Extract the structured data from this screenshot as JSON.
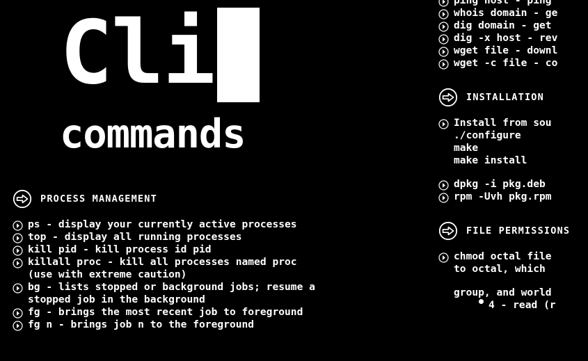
{
  "theme": {
    "background": "#000000",
    "foreground": "#ffffff"
  },
  "title": {
    "text": "Cli",
    "cursor": "block-cursor",
    "subtitle": "commands"
  },
  "left_column": {
    "sections": [
      {
        "heading": "PROCESS MANAGEMENT",
        "heading_icon": "circle-arrow-right-icon",
        "entries": [
          {
            "icon": "circle-play-icon",
            "lines": [
              "ps - display your currently active processes"
            ]
          },
          {
            "icon": "circle-play-icon",
            "lines": [
              "top - display all running processes"
            ]
          },
          {
            "icon": "circle-play-icon",
            "lines": [
              "kill pid - kill process id pid"
            ]
          },
          {
            "icon": "circle-play-icon",
            "lines": [
              "killall proc - kill all processes named proc",
              "(use with extreme caution)"
            ]
          },
          {
            "icon": "circle-play-icon",
            "lines": [
              "bg - lists stopped or background jobs; resume a",
              "stopped job in the background"
            ]
          },
          {
            "icon": "circle-play-icon",
            "lines": [
              "fg - brings the most recent job to foreground"
            ]
          },
          {
            "icon": "circle-play-icon",
            "lines": [
              "fg n - brings job n to the foreground"
            ]
          }
        ]
      }
    ]
  },
  "right_column": {
    "networking_entries": [
      {
        "icon": "circle-play-icon",
        "lines": [
          "ping host - ping"
        ]
      },
      {
        "icon": "circle-play-icon",
        "lines": [
          "whois domain - ge"
        ]
      },
      {
        "icon": "circle-play-icon",
        "lines": [
          "dig domain - get"
        ]
      },
      {
        "icon": "circle-play-icon",
        "lines": [
          "dig -x host - rev"
        ]
      },
      {
        "icon": "circle-play-icon",
        "lines": [
          "wget file - downl"
        ]
      },
      {
        "icon": "circle-play-icon",
        "lines": [
          "wget -c file - co"
        ]
      }
    ],
    "sections": [
      {
        "heading": "INSTALLATION",
        "heading_icon": "circle-arrow-right-icon",
        "entries": [
          {
            "icon": "circle-play-icon",
            "lines": [
              "Install from sou",
              "./configure",
              "make",
              "make install"
            ]
          }
        ],
        "entries2": [
          {
            "icon": "circle-play-icon",
            "lines": [
              "dpkg -i pkg.deb "
            ]
          },
          {
            "icon": "circle-play-icon",
            "lines": [
              "rpm -Uvh pkg.rpm"
            ]
          }
        ]
      },
      {
        "heading": "FILE PERMISSIONS",
        "heading_icon": "circle-arrow-right-icon",
        "entries": [
          {
            "icon": "circle-play-icon",
            "lines": [
              "chmod octal file",
              "to octal, which "
            ]
          }
        ],
        "entries2": [
          {
            "icon": "none",
            "lines": [
              "group, and world"
            ]
          }
        ],
        "sub_bullet": "4 - read (r"
      }
    ]
  }
}
